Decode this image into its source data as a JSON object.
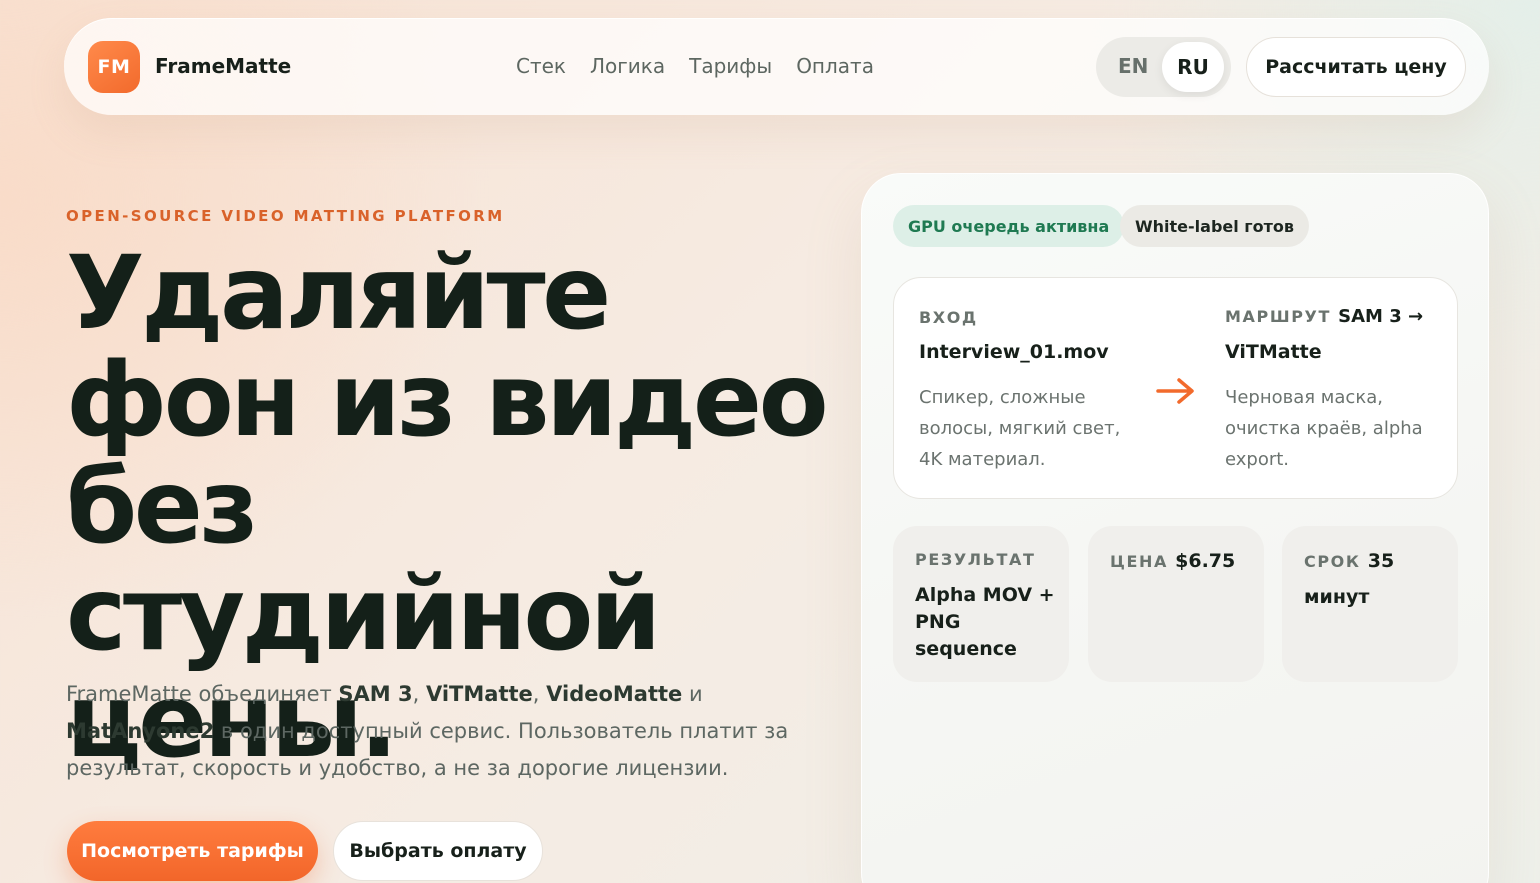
{
  "nav": {
    "logo_badge": "FM",
    "brand": "FrameMatte",
    "links": [
      "Стек",
      "Логика",
      "Тарифы",
      "Оплата"
    ],
    "lang_en": "EN",
    "lang_ru": "RU",
    "lang_active": "RU",
    "cta": "Рассчитать цену"
  },
  "hero": {
    "eyebrow": "OPEN-SOURCE VIDEO MATTING PLATFORM",
    "headline": "Удаляйте фон из видео без студийной цены.",
    "lead": {
      "p1": "FrameMatte объединяет ",
      "m1": "SAM 3",
      "s1": ", ",
      "m2": "ViTMatte",
      "s2": ", ",
      "m3": "VideoMatte",
      "s3": " и ",
      "m4": "MatAnyone2",
      "p2": " в один доступный сервис. Пользователь платит за результат, скорость и удобство, а не за дорогие лицензии."
    },
    "primary_button": "Посмотреть тарифы",
    "secondary_button": "Выбрать оплату"
  },
  "card": {
    "chip_status": "GPU очередь активна",
    "chip_whitelabel": "White-label готов",
    "input": {
      "label": "ВХОД",
      "title": "Interview_01.mov",
      "description": "Спикер, сложные волосы, мягкий свет, 4K материал."
    },
    "route": {
      "label": "МАРШРУТ",
      "label_value": "SAM 3 →",
      "title": "ViTMatte",
      "description": "Черновая маска, очистка краёв, alpha export."
    },
    "stats": {
      "result_label": "РЕЗУЛЬТАТ",
      "result_value": "Alpha MOV + PNG sequence",
      "price_label": "ЦЕНА",
      "price_value": "$6.75",
      "time_label": "СРОК",
      "time_value_1": "35",
      "time_value_2": "минут"
    }
  },
  "colors": {
    "accent": "#f26a2c",
    "ink": "#142019",
    "status_green": "#1f7a52"
  },
  "icons": {
    "route_arrow": "arrow-right-icon"
  }
}
